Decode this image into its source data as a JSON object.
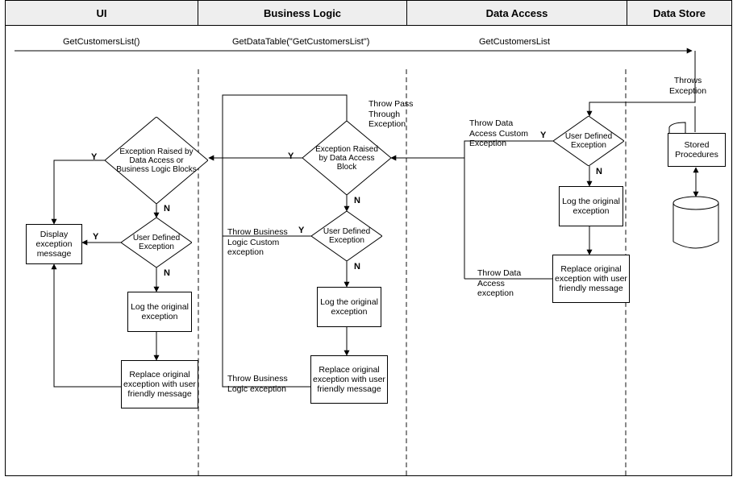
{
  "headers": {
    "ui": "UI",
    "bl": "Business Logic",
    "da": "Data Access",
    "ds": "Data Store"
  },
  "calls": {
    "c1": "GetCustomersList()",
    "c2": "GetDataTable(\"GetCustomersList\")",
    "c3": "GetCustomersList",
    "c4": "Throws\nException"
  },
  "ui": {
    "decision1": "Exception Raised by Data Access or Business Logic Blocks",
    "decision2": "User Defined Exception",
    "display": "Display exception message",
    "log": "Log the original exception",
    "replace": "Replace original exception with user friendly message"
  },
  "bl": {
    "passthrough": "Throw Pass Through Exception",
    "decision1": "Exception Raised by Data Access Block",
    "decision2": "User Defined Exception",
    "custom": "Throw Business Logic Custom exception",
    "log": "Log the original exception",
    "replace": "Replace original exception with user friendly message",
    "throw": "Throw Business Logic exception"
  },
  "da": {
    "custom": "Throw Data Access Custom Exception",
    "decision1": "User Defined Exception",
    "log": "Log the original exception",
    "replace": "Replace original exception with user friendly message",
    "throw": "Throw Data Access exception"
  },
  "ds": {
    "sp": "Stored Procedures"
  },
  "yn": {
    "y": "Y",
    "n": "N"
  }
}
